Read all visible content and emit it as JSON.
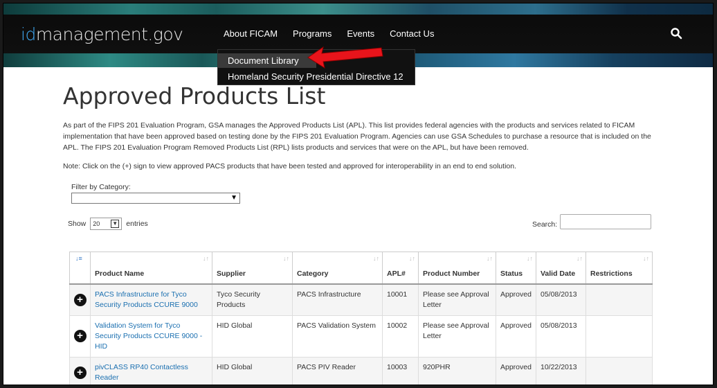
{
  "header": {
    "logo_id": "id",
    "logo_rest": "management.gov",
    "nav": [
      "About FICAM",
      "Programs",
      "Events",
      "Contact Us"
    ],
    "dropdown": [
      "Document Library",
      "Homeland Security Presidential Directive 12"
    ]
  },
  "page": {
    "title": "Approved Products List",
    "intro": "As part of the FIPS 201 Evaluation Program, GSA manages the Approved Products List (APL). This list provides federal agencies with the products and services related to FICAM implementation that have been approved based on testing done by the FIPS 201 Evaluation Program. Agencies can use GSA Schedules to purchase a resource that is included on the APL. The FIPS 201 Evaluation Program Removed Products List (RPL) lists products and services that were on the APL, but have been removed.",
    "note": "Note: Click on the (+) sign to view approved PACS products that have been tested and approved for interoperability in an end to end solution.",
    "filter_label": "Filter by Category:",
    "show_label": "Show",
    "entries_value": "20",
    "entries_label": "entries",
    "search_label": "Search:"
  },
  "table": {
    "columns": [
      "Product Name",
      "Supplier",
      "Category",
      "APL#",
      "Product Number",
      "Status",
      "Valid Date",
      "Restrictions"
    ],
    "rows": [
      {
        "name": "PACS Infrastructure for Tyco Security Products CCURE 9000",
        "supplier": "Tyco Security Products",
        "category": "PACS Infrastructure",
        "apl": "10001",
        "pnum": "Please see Approval Letter",
        "status": "Approved",
        "date": "05/08/2013",
        "restr": ""
      },
      {
        "name": "Validation System for Tyco Security Products CCURE 9000 - HID",
        "supplier": "HID Global",
        "category": "PACS Validation System",
        "apl": "10002",
        "pnum": "Please see Approval Letter",
        "status": "Approved",
        "date": "05/08/2013",
        "restr": ""
      },
      {
        "name": "pivCLASS RP40 Contactless Reader",
        "supplier": "HID Global",
        "category": "PACS PIV Reader",
        "apl": "10003",
        "pnum": "920PHR",
        "status": "Approved",
        "date": "10/22/2013",
        "restr": ""
      }
    ]
  },
  "colors": {
    "link": "#1a6fb0",
    "logo_accent": "#3fa9f5",
    "arrow": "#e8141b"
  }
}
